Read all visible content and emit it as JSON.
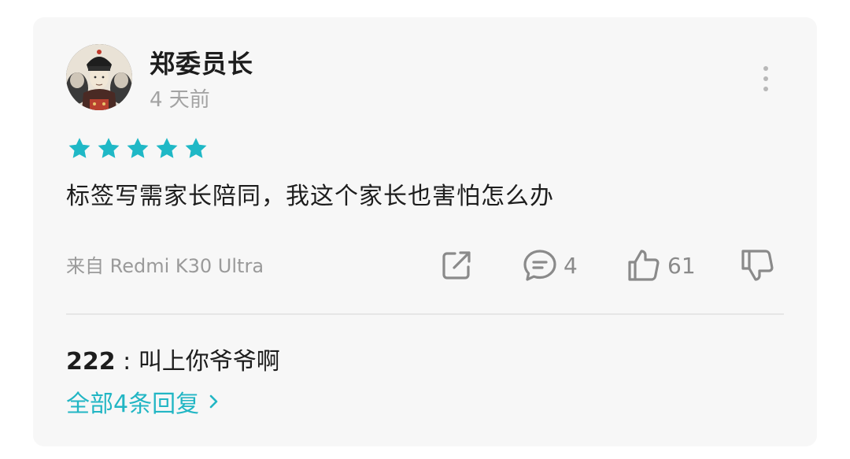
{
  "user": {
    "name": "郑委员长",
    "time_ago": "4 天前",
    "avatar": "portrait-avatar"
  },
  "rating": {
    "stars": 5,
    "max": 5,
    "color": "#1fb8c6"
  },
  "review": {
    "text": "标签写需家长陪同，我这个家长也害怕怎么办",
    "device": "来自 Redmi K30 Ultra"
  },
  "actions": {
    "share": {
      "icon": "share-icon"
    },
    "reply": {
      "icon": "comment-icon",
      "count": "4"
    },
    "like": {
      "icon": "thumbs-up-icon",
      "count": "61"
    },
    "dislike": {
      "icon": "thumbs-down-icon"
    }
  },
  "replies": {
    "first": {
      "user": "222",
      "separator": " : ",
      "text": "叫上你爷爷啊"
    },
    "view_all_label": "全部4条回复"
  },
  "colors": {
    "card_bg": "#f7f7f7",
    "accent": "#22b6c4",
    "icon_gray": "#8a8a8a"
  }
}
